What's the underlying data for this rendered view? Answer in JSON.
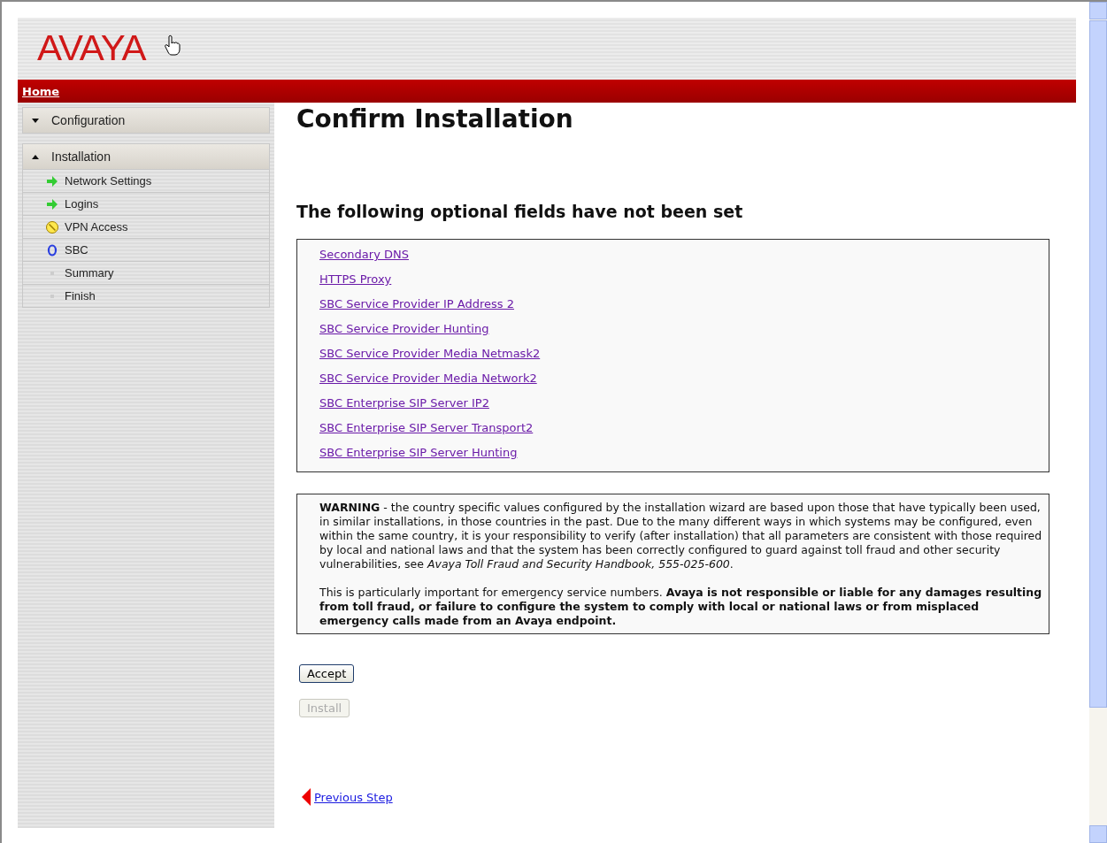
{
  "header": {
    "logo": "AVAYA"
  },
  "nav_bar": {
    "home_link": "Home"
  },
  "sidebar": {
    "sections": [
      {
        "label": "Configuration",
        "expanded": false
      },
      {
        "label": "Installation",
        "expanded": true,
        "items": [
          {
            "label": "Network Settings",
            "kind": "done"
          },
          {
            "label": "Logins",
            "kind": "done"
          },
          {
            "label": "VPN Access",
            "kind": "skipped"
          },
          {
            "label": "SBC",
            "kind": "current"
          },
          {
            "label": "Summary",
            "kind": "pending"
          },
          {
            "label": "Finish",
            "kind": "pending"
          }
        ]
      }
    ]
  },
  "main": {
    "title": "Confirm Installation",
    "subtitle": "The following optional fields have not been set",
    "unset_fields": [
      "Secondary DNS",
      "HTTPS Proxy",
      "SBC Service Provider IP Address 2",
      "SBC Service Provider Hunting",
      "SBC Service Provider Media Netmask2",
      "SBC Service Provider Media Network2",
      "SBC Enterprise SIP Server IP2",
      "SBC Enterprise SIP Server Transport2",
      "SBC Enterprise SIP Server Hunting"
    ],
    "warning": [
      "**WARNING** - the country specific values configured by the installation wizard are based upon those that have typically been used, in similar installations, in those countries in the past. Due to the many different ways in which systems may be configured, even within the same country, it is your responsibility to verify (after installation) that all parameters are consistent with those required by local and national laws and that the system has been correctly configured to guard against toll fraud and other security vulnerabilities, see *Avaya Toll Fraud and Security Handbook, 555-025-600*.",
      "This is particularly important for emergency service numbers. **Avaya is not responsible or liable for any damages resulting from toll fraud, or failure to configure the system to comply with local or national laws or from misplaced emergency calls made from an Avaya endpoint.**"
    ],
    "buttons": [
      {
        "label": "Accept",
        "disabled": false
      },
      {
        "label": "Install",
        "disabled": true
      }
    ],
    "previous_link": "Previous Step"
  }
}
